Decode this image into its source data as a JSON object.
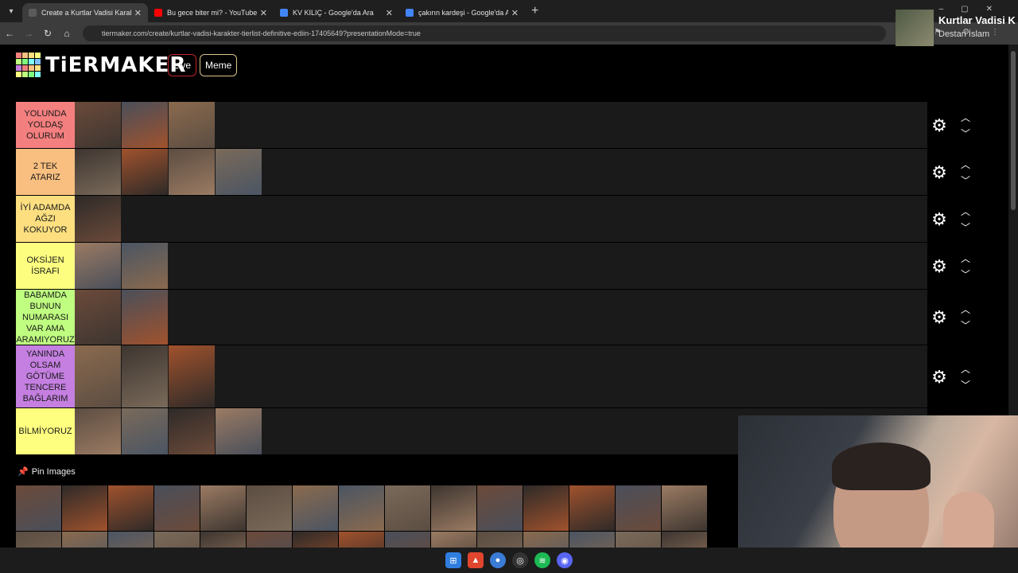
{
  "browser": {
    "tabs": [
      {
        "title": "Create a Kurtlar Vadisi Karakter",
        "favicon_color": "#5b5b5b",
        "active": true
      },
      {
        "title": "Bu gece biter mi? - YouTube",
        "favicon_color": "#ff0000",
        "active": false
      },
      {
        "title": "KV KILIÇ - Google'da Ara",
        "favicon_color": "#4285f4",
        "active": false
      },
      {
        "title": "çakırın kardeşi - Google'da Ara",
        "favicon_color": "#4285f4",
        "active": false
      }
    ],
    "url": "tiermaker.com/create/kurtlar-vadisi-karakter-tierlist-definitive-ediin-17405649?presentationMode=true"
  },
  "header": {
    "logo_text": "TiERMAKER",
    "live_label": "Live",
    "meme_label": "Meme"
  },
  "tiers": [
    {
      "label": "YOLUNDA YOLDAŞ OLURUM",
      "color": "#f47f7f",
      "count": 3
    },
    {
      "label": "2 TEK ATARIZ",
      "color": "#f8bf80",
      "count": 4
    },
    {
      "label": "İYİ ADAMDA AĞZI KOKUYOR",
      "color": "#fddf80",
      "count": 1
    },
    {
      "label": "OKSİJEN İSRAFI",
      "color": "#fdfe80",
      "count": 2
    },
    {
      "label": "BABAMDA BUNUN NUMARASI VAR AMA ARAMIYORUZ",
      "color": "#bffe80",
      "count": 2
    },
    {
      "label": "YANINDA OLSAM GÖTÜME TENCERE BAĞLARIM",
      "color": "#c47fe0",
      "count": 3
    },
    {
      "label": "BİLMİYORUZ",
      "color": "#ffff7f",
      "count": 4
    }
  ],
  "pin_images_label": "Pin Images",
  "overlay": {
    "title": "Kurtlar Vadisi K",
    "subtitle": "Destan İslam"
  },
  "colors": {
    "logo_grid": [
      "#f47f7f",
      "#f8bf80",
      "#fddf80",
      "#fdfe80",
      "#bffe80",
      "#7fff7f",
      "#7fffff",
      "#7fbfff",
      "#c47fe0",
      "#f47f7f",
      "#f8bf80",
      "#fddf80",
      "#fdfe80",
      "#bffe80",
      "#7fff7f",
      "#7fffff"
    ]
  }
}
